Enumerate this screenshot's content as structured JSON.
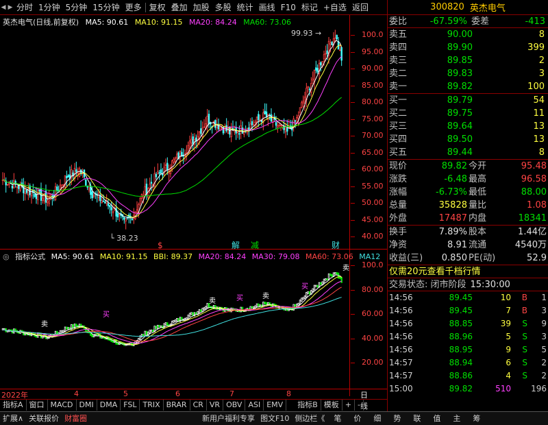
{
  "toolbar": {
    "items": [
      "分时",
      "1分钟",
      "5分钟",
      "15分钟",
      "更多",
      "复权",
      "叠加",
      "加股",
      "多股",
      "统计",
      "画线",
      "F10",
      "标记",
      "+自选",
      "返回"
    ]
  },
  "stock": {
    "code": "300820",
    "name": "英杰电气",
    "chart_title": "英杰电气(日线,前复权)",
    "ma_legend": [
      {
        "label": "MA5: 90.61",
        "color": "#ffffff"
      },
      {
        "label": "MA10: 91.15",
        "color": "#ffff40"
      },
      {
        "label": "MA20: 84.24",
        "color": "#ff40ff"
      },
      {
        "label": "MA60: 73.06",
        "color": "#00e000"
      }
    ],
    "high_annotation": "99.93",
    "low_annotation": "38.23"
  },
  "price_axis": [
    "100.0",
    "95.00",
    "90.00",
    "85.00",
    "80.00",
    "75.00",
    "70.00",
    "65.00",
    "60.00",
    "55.00",
    "50.00",
    "45.00",
    "40.00"
  ],
  "signals": [
    {
      "text": "$",
      "color": "#ff4444"
    },
    {
      "text": "解",
      "color": "#40e0e0"
    },
    {
      "text": "减",
      "color": "#00e000"
    },
    {
      "text": "财",
      "color": "#40e0e0"
    }
  ],
  "sub_chart": {
    "title": "指标公式",
    "legend": [
      {
        "label": "MA5: 90.61",
        "color": "#ffffff"
      },
      {
        "label": "MA10: 91.15",
        "color": "#ffff40"
      },
      {
        "label": "BBI: 89.37",
        "color": "#ffff40"
      },
      {
        "label": "MA20: 84.24",
        "color": "#ff40ff"
      },
      {
        "label": "MA30: 79.08",
        "color": "#ff40ff"
      },
      {
        "label": "MA60: 73.06",
        "color": "#ff4444"
      },
      {
        "label": "MA12",
        "color": "#40e0e0"
      }
    ],
    "axis": [
      "100.0",
      "80.00",
      "60.00",
      "40.00",
      "20.00"
    ],
    "buy_label": "买",
    "sell_label": "卖"
  },
  "date_axis": [
    "2022年",
    "4",
    "5",
    "6",
    "7",
    "8",
    "日线"
  ],
  "tabs": [
    "指标A",
    "窗口",
    "MACD",
    "DMI",
    "DMA",
    "FSL",
    "TRIX",
    "BRAR",
    "CR",
    "VR",
    "OBV",
    "ASI",
    "EMV",
    "指标B",
    "模板",
    "+",
    "-"
  ],
  "bottom_bar": {
    "left": [
      "扩展∧",
      "关联报价",
      "财富圈"
    ],
    "center": [
      "新用户福利专享",
      "图文F10",
      "侧边栏《"
    ],
    "right": [
      "笔",
      "价",
      "细",
      "势",
      "联",
      "值",
      "主",
      "筹"
    ]
  },
  "quote": {
    "wei_bi_label": "委比",
    "wei_bi": "-67.59%",
    "wei_cha_label": "委差",
    "wei_cha": "-413",
    "asks": [
      {
        "label": "卖五",
        "price": "90.00",
        "vol": "8"
      },
      {
        "label": "卖四",
        "price": "89.90",
        "vol": "399"
      },
      {
        "label": "卖三",
        "price": "89.85",
        "vol": "2"
      },
      {
        "label": "卖二",
        "price": "89.83",
        "vol": "3"
      },
      {
        "label": "卖一",
        "price": "89.82",
        "vol": "100"
      }
    ],
    "bids": [
      {
        "label": "买一",
        "price": "89.79",
        "vol": "54"
      },
      {
        "label": "买二",
        "price": "89.75",
        "vol": "11"
      },
      {
        "label": "买三",
        "price": "89.64",
        "vol": "13"
      },
      {
        "label": "买四",
        "price": "89.50",
        "vol": "13"
      },
      {
        "label": "买五",
        "price": "89.44",
        "vol": "8"
      }
    ],
    "stats": [
      {
        "l1": "现价",
        "v1": "89.82",
        "c1": "green",
        "l2": "今开",
        "v2": "95.48",
        "c2": "red"
      },
      {
        "l1": "涨跌",
        "v1": "-6.48",
        "c1": "green",
        "l2": "最高",
        "v2": "96.58",
        "c2": "red"
      },
      {
        "l1": "涨幅",
        "v1": "-6.73%",
        "c1": "green",
        "l2": "最低",
        "v2": "88.00",
        "c2": "green"
      },
      {
        "l1": "总量",
        "v1": "35828",
        "c1": "yellow",
        "l2": "量比",
        "v2": "1.08",
        "c2": "red"
      },
      {
        "l1": "外盘",
        "v1": "17487",
        "c1": "red",
        "l2": "内盘",
        "v2": "18341",
        "c2": "green"
      }
    ],
    "stats2": [
      {
        "l1": "换手",
        "v1": "7.89%",
        "l2": "股本",
        "v2": "1.44亿"
      },
      {
        "l1": "净资",
        "v1": "8.91",
        "l2": "流通",
        "v2": "4540万"
      },
      {
        "l1": "收益(三)",
        "v1": "0.850",
        "l2": "PE(动)",
        "v2": "52.9"
      }
    ],
    "promo": "仅需20元查看千档行情",
    "trade_status_label": "交易状态: 闭市阶段",
    "trade_status_time": "15:30:00"
  },
  "ticks": [
    {
      "time": "14:56",
      "price": "89.45",
      "vol": "10",
      "side": "B",
      "count": "1"
    },
    {
      "time": "14:56",
      "price": "89.45",
      "vol": "7",
      "side": "B",
      "count": "3"
    },
    {
      "time": "14:56",
      "price": "88.85",
      "vol": "39",
      "side": "S",
      "count": "9"
    },
    {
      "time": "14:56",
      "price": "88.96",
      "vol": "5",
      "side": "S",
      "count": "3"
    },
    {
      "time": "14:56",
      "price": "88.95",
      "vol": "9",
      "side": "S",
      "count": "5"
    },
    {
      "time": "14:57",
      "price": "88.94",
      "vol": "6",
      "side": "S",
      "count": "2"
    },
    {
      "time": "14:57",
      "price": "88.86",
      "vol": "4",
      "side": "S",
      "count": "2"
    },
    {
      "time": "15:00",
      "price": "89.82",
      "vol": "510",
      "side": "",
      "count": "196"
    }
  ],
  "chart_data": {
    "type": "candlestick",
    "ylim": [
      37,
      102
    ],
    "ma_series": [
      "MA5",
      "MA10",
      "MA20",
      "MA60"
    ],
    "high": 99.93,
    "low": 38.23
  }
}
